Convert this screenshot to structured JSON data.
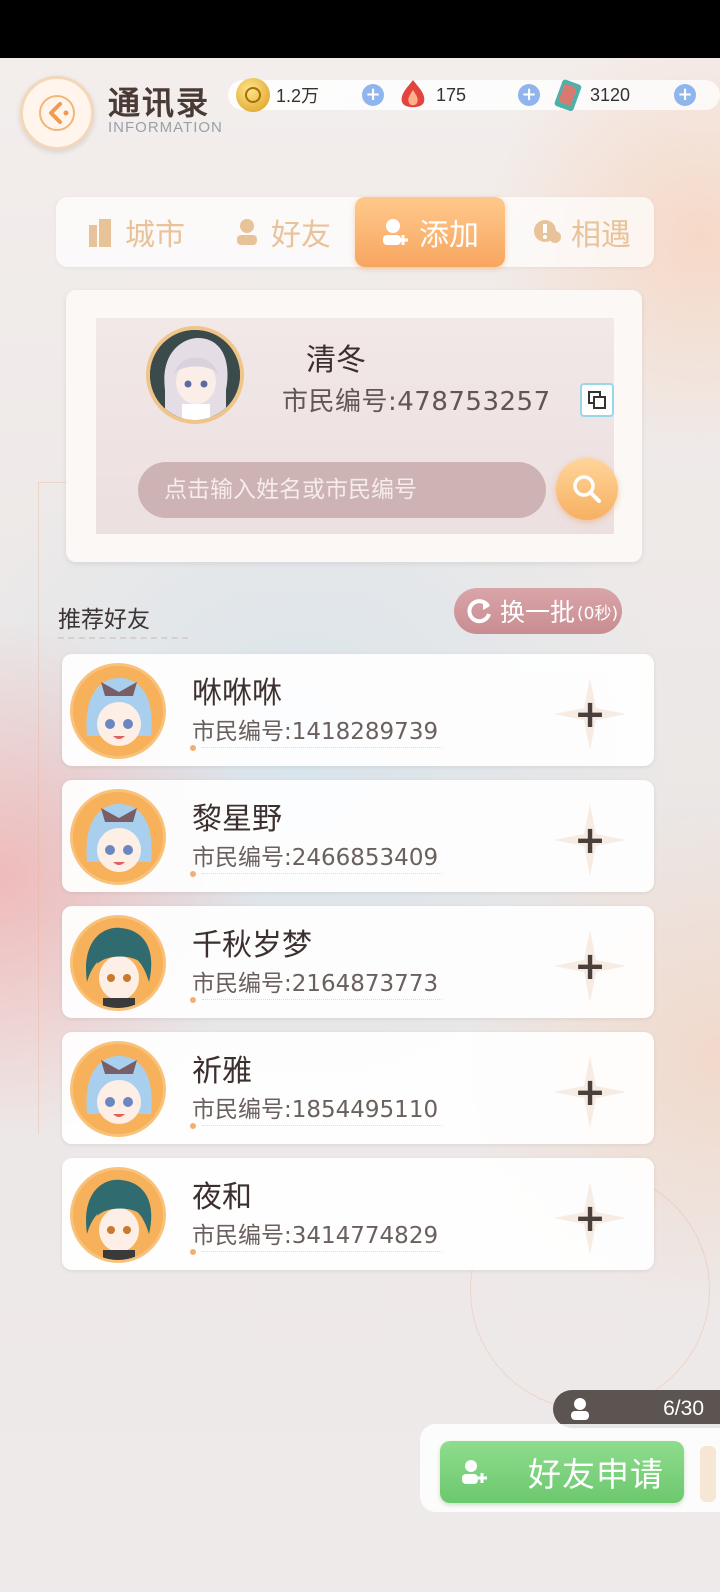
{
  "header": {
    "title": "通讯录",
    "subtitle": "INFORMATION"
  },
  "currencies": [
    {
      "name": "gold-coin",
      "value": "1.2万",
      "color": "#e8b23a"
    },
    {
      "name": "red-crystal",
      "value": "175",
      "color": "#e2453f"
    },
    {
      "name": "card-ticket",
      "value": "3120",
      "color": "#4fb0a8"
    }
  ],
  "tabs": [
    {
      "label": "城市",
      "icon": "building-icon"
    },
    {
      "label": "好友",
      "icon": "friend-icon"
    },
    {
      "label": "添加",
      "icon": "add-user-icon",
      "active": true
    },
    {
      "label": "相遇",
      "icon": "encounter-icon"
    }
  ],
  "profile": {
    "name": "清冬",
    "id_label": "市民编号:478753257"
  },
  "search": {
    "placeholder": "点击输入姓名或市民编号"
  },
  "recommend": {
    "title": "推荐好友",
    "refresh_label": "换一批",
    "refresh_count": "(0秒)"
  },
  "friends": [
    {
      "name": "咻咻咻",
      "id": "市民编号:1418289739",
      "avatar": "girl-blue-hair"
    },
    {
      "name": "黎星野",
      "id": "市民编号:2466853409",
      "avatar": "girl-blue-hair"
    },
    {
      "name": "千秋岁梦",
      "id": "市民编号:2164873773",
      "avatar": "boy-teal-hair"
    },
    {
      "name": "祈雅",
      "id": "市民编号:1854495110",
      "avatar": "girl-blue-hair"
    },
    {
      "name": "夜和",
      "id": "市民编号:3414774829",
      "avatar": "boy-teal-hair"
    }
  ],
  "requests": {
    "counter": "6/30",
    "button_label": "好友申请"
  },
  "colors": {
    "accent_orange": "#f7a65f",
    "tab_inactive": "#e8c39a",
    "green_button": "#6cc86d"
  }
}
